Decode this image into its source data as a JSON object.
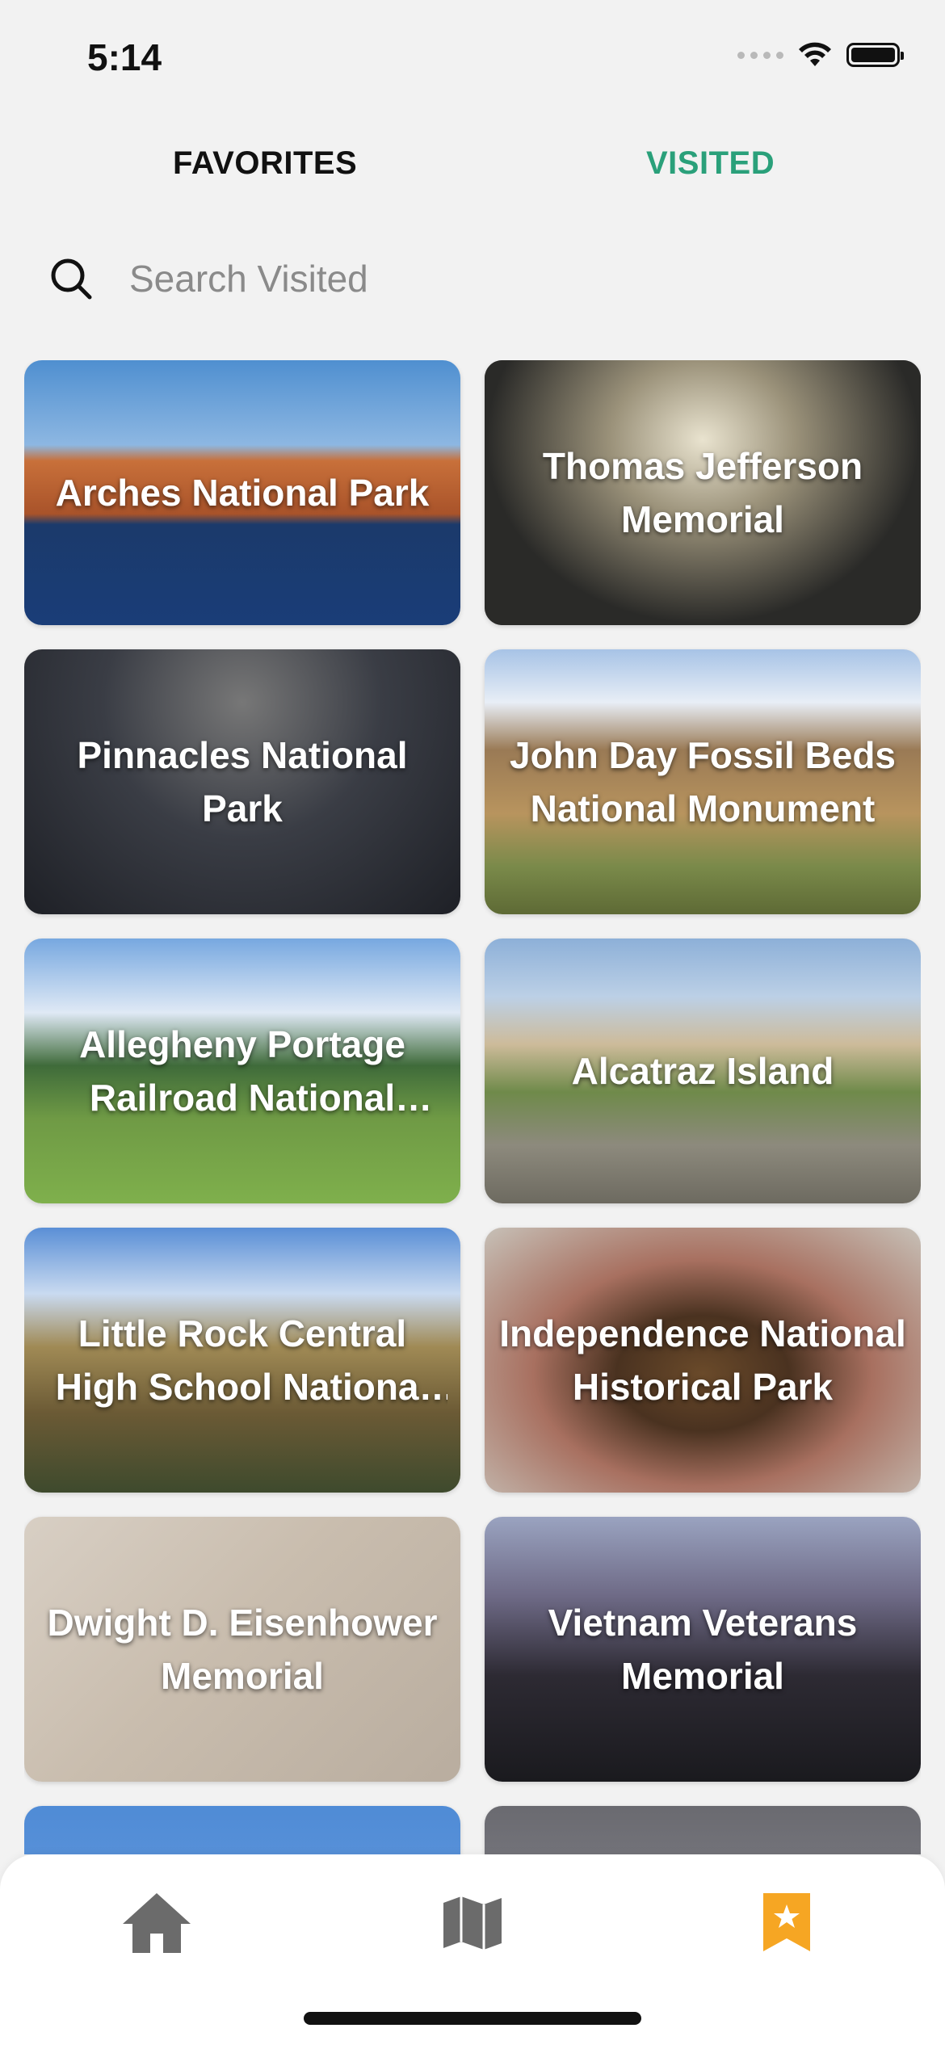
{
  "status_bar": {
    "time": "5:14"
  },
  "tabs": {
    "favorites": "FAVORITES",
    "visited": "VISITED"
  },
  "search": {
    "placeholder": "Search Visited"
  },
  "cards": [
    "Arches National Park",
    "Thomas Jefferson Memorial",
    "Pinnacles National Park",
    "John Day Fossil Beds National Monument",
    "Allegheny Portage Railroad National Historic Site",
    "Alcatraz Island",
    "Little Rock Central High School National Historic Site",
    "Independence National Historical Park",
    "Dwight D. Eisenhower Memorial",
    "Vietnam Veterans Memorial",
    "",
    ""
  ],
  "colors": {
    "accent": "#2aa07a",
    "active_nav": "#f6a623",
    "inactive_nav": "#6b6b6b"
  },
  "bottom_nav": {
    "items": [
      "home-icon",
      "map-icon",
      "bookmark-star-icon"
    ],
    "active": "bookmark-star-icon"
  }
}
